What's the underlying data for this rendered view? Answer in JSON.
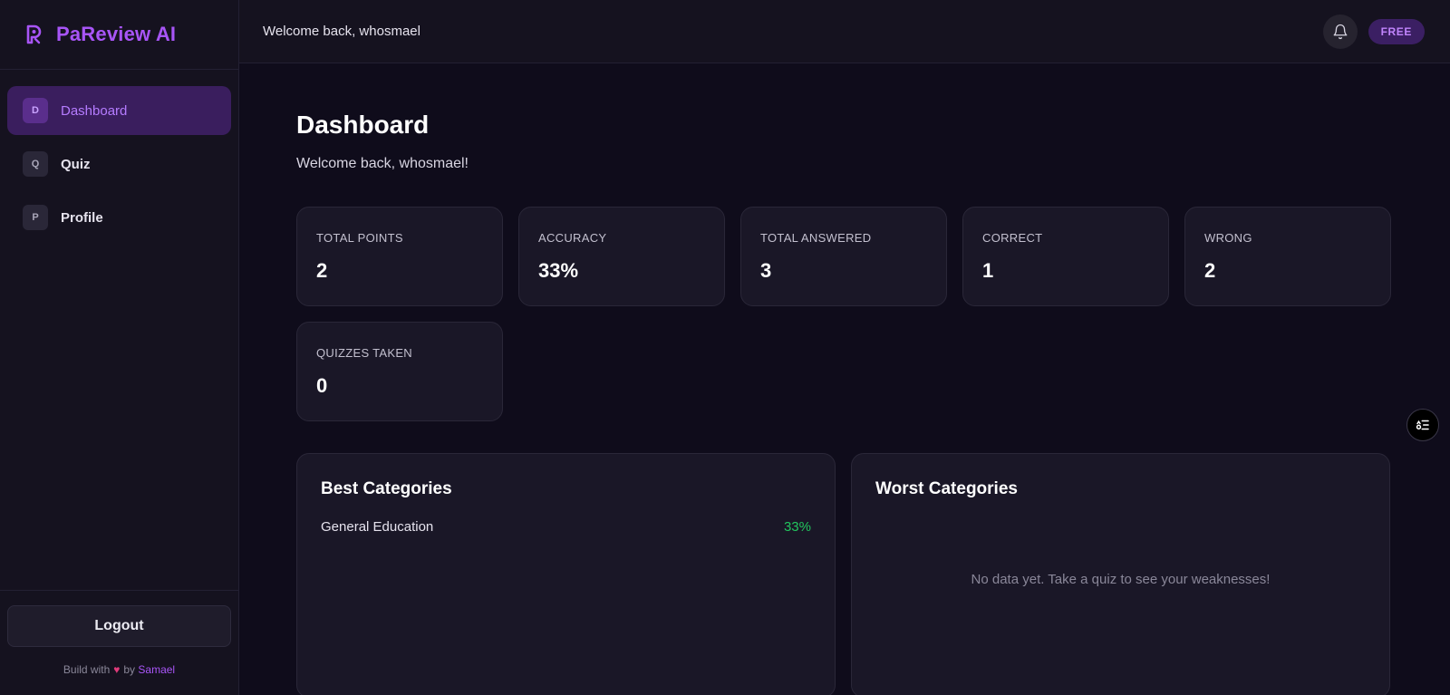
{
  "brand": {
    "name": "PaReview AI"
  },
  "sidebar": {
    "items": [
      {
        "badge": "D",
        "label": "Dashboard"
      },
      {
        "badge": "Q",
        "label": "Quiz"
      },
      {
        "badge": "P",
        "label": "Profile"
      }
    ],
    "logout_label": "Logout",
    "credit_prefix": "Build with",
    "credit_by": "by",
    "credit_author": "Samael"
  },
  "topbar": {
    "welcome": "Welcome back, whosmael",
    "plan": "FREE"
  },
  "main": {
    "title": "Dashboard",
    "subtitle": "Welcome back, whosmael!",
    "stats": [
      {
        "label": "TOTAL POINTS",
        "value": "2"
      },
      {
        "label": "ACCURACY",
        "value": "33%"
      },
      {
        "label": "TOTAL ANSWERED",
        "value": "3"
      },
      {
        "label": "CORRECT",
        "value": "1"
      },
      {
        "label": "WRONG",
        "value": "2"
      },
      {
        "label": "QUIZZES TAKEN",
        "value": "0"
      }
    ],
    "best": {
      "title": "Best Categories",
      "rows": [
        {
          "name": "General Education",
          "pct": "33%"
        }
      ]
    },
    "worst": {
      "title": "Worst Categories",
      "empty": "No data yet. Take a quiz to see your weaknesses!"
    }
  },
  "colors": {
    "accent": "#a855f7",
    "background": "#0f0c1b",
    "card": "#1a1727",
    "success": "#22c55e"
  },
  "icons": {
    "brand": "brand-logo-icon",
    "notifications": "bell-icon",
    "floating": "filter-list-icon",
    "heart": "heart-icon"
  }
}
